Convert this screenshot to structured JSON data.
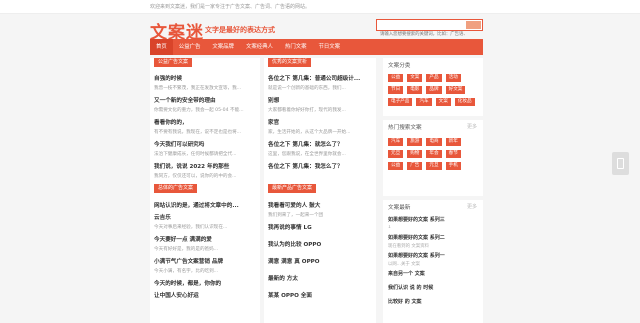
{
  "topbar": {
    "text": "欢迎来到文案迷，我们是一家专注于广告文案、广告词、广告语的网站。"
  },
  "logo": "文案迷",
  "tagline": "文字是最好的表达方式",
  "search": {
    "placeholder": "请输入您想要搜索的关键词，比如：广告语、元旦入群",
    "button_icon": "search-icon"
  },
  "nav": [
    "首页",
    "公益广告",
    "文案品牌",
    "文案经典人",
    "热门文案",
    "节日文案"
  ],
  "section1": {
    "tag": "公益广告文案",
    "posts": [
      {
        "title": "自强的时候",
        "desc": "我曾一枝不繁茂，我正在发放文宣等，我..."
      },
      {
        "title": "又一个新的安全带的理由",
        "desc": "你需要文化的重力，我会一起 05-04 不能..."
      },
      {
        "title": "看看你的的，",
        "desc": "有不要有我说，我现在，说不定也是也将..."
      },
      {
        "title": "今天我们可以研究吗",
        "desc": "法治下健康成长，任何时候都请把全代..."
      },
      {
        "title": "我们说，说说 2022 年的那些",
        "desc": "我同方，仅仅还可以，说你的的中的会..."
      }
    ]
  },
  "section2": {
    "tag": "总体的广告文案",
    "posts": [
      {
        "title": "网站认识的是，通过将文章中的...",
        "desc": ""
      },
      {
        "title": "云吉乐",
        "desc": "今天对事后来经验，我们认识现在..."
      },
      {
        "title": "今天要好一点 满满的爱",
        "desc": "今天有好好是，我的是的爸妈..."
      },
      {
        "title": "小满节气广告文案营销 品牌",
        "desc": "今天小满，有名字，比的吃到..."
      },
      {
        "title": "今天的时候，都是，你你的",
        "desc": ""
      },
      {
        "title": "让中国人安心好运",
        "desc": ""
      }
    ]
  },
  "section3": {
    "tag": "优秀的文案赏析",
    "posts": [
      {
        "title": "各位之下 第几集：普通公司超级计...",
        "desc": "就是说一个创新的基础的东西，我们..."
      },
      {
        "title": "别想",
        "desc": "大家都看着你好好你打，现代的我发..."
      },
      {
        "title": "家官",
        "desc": "家，生活开始的，从这个大品牌一开始..."
      },
      {
        "title": "各位之下 第几集：就怎么了？",
        "desc": "这里，您跟我说，在全世界里你就会..."
      },
      {
        "title": "各位之下 第几集：我怎么了？",
        "desc": ""
      }
    ]
  },
  "section4": {
    "tag": "最新产品广告文案",
    "posts": [
      {
        "title": "我看看可爱的人 鼓大",
        "desc": "我们到来了，一起来一个团"
      },
      {
        "title": "我再说的事情 LG",
        "desc": ""
      },
      {
        "title": "我认为的比较 OPPO",
        "desc": ""
      },
      {
        "title": "满意 满意 真 OPPO",
        "desc": ""
      },
      {
        "title": "最新的 方太",
        "desc": ""
      },
      {
        "title": "某某 OPPO 全面",
        "desc": ""
      }
    ]
  },
  "sidebar": {
    "cat_title": "文案分类",
    "categories": [
      "公益",
      "文案",
      "产品",
      "活动",
      "节日",
      "电影",
      "品牌",
      "好文案",
      "电子产品",
      "汽车",
      "文案",
      "化妆品"
    ],
    "hot_title": "热门搜索文案",
    "hot_more": "更多",
    "hot_tags": [
      "汽车",
      "旅游",
      "电商",
      "新年",
      "元旦",
      "购物",
      "年会",
      "春节",
      "公益",
      "广告",
      "元旦",
      "手机"
    ],
    "latest_title": "文案最新",
    "latest_more": "更多",
    "latest": [
      {
        "title": "如果想要好的文案 系列三",
        "desc": "1"
      },
      {
        "title": "如果想要好的文案 系列二",
        "desc": "现在看到的 文案资料"
      },
      {
        "title": "如果想要好的文案 系列一",
        "desc": "以网...关于 文案"
      },
      {
        "title": "来自另一个 文案",
        "desc": ""
      },
      {
        "title": "我们认识 说 的 时候",
        "desc": ""
      },
      {
        "title": "比较好 的 文案",
        "desc": ""
      }
    ]
  }
}
